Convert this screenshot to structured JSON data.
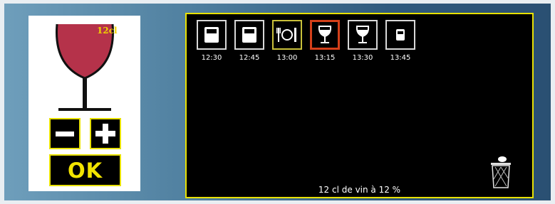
{
  "glass": {
    "label": "12cl",
    "wine_color": "#b5324a"
  },
  "controls": {
    "minus_label": "−",
    "plus_label": "+",
    "ok_label": "OK"
  },
  "timeline": [
    {
      "time": "12:30",
      "icon": "glass-of-water-icon",
      "kind": "water"
    },
    {
      "time": "12:45",
      "icon": "glass-of-water-icon",
      "kind": "water"
    },
    {
      "time": "13:00",
      "icon": "meal-icon",
      "kind": "meal"
    },
    {
      "time": "13:15",
      "icon": "wine-glass-icon",
      "kind": "wine",
      "selected": true
    },
    {
      "time": "13:30",
      "icon": "wine-glass-icon",
      "kind": "wine"
    },
    {
      "time": "13:45",
      "icon": "small-glass-icon",
      "kind": "small"
    }
  ],
  "status": {
    "message": "12 cl de vin à 12 %"
  },
  "colors": {
    "accent_yellow": "#e8e100",
    "selected_border": "#d4401a",
    "panel_bg": "#000000"
  }
}
